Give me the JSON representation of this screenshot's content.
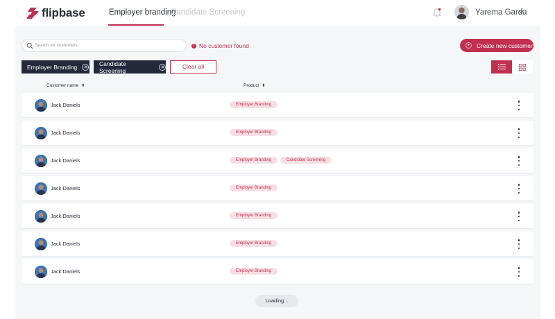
{
  "header": {
    "logo_text": "flipbase",
    "tabs": [
      {
        "label": "Employer branding",
        "active": true
      },
      {
        "label": "Candidate Screening",
        "active": false
      }
    ],
    "user_name": "Yarema Garda"
  },
  "toolbar": {
    "search_placeholder": "Search for customers",
    "search_value": "",
    "no_result_text": "No customer found",
    "create_label": "Create new customer",
    "filters": [
      {
        "label": "Employer Branding"
      },
      {
        "label": "Candidate Screening"
      }
    ],
    "clear_label": "Clear all"
  },
  "table": {
    "columns": [
      "Customer name",
      "Product"
    ],
    "rows": [
      {
        "name": "Jack Daniels",
        "products": [
          "Employer Branding"
        ]
      },
      {
        "name": "Jack Daniels",
        "products": [
          "Employer Branding"
        ]
      },
      {
        "name": "Jack Daniels",
        "products": [
          "Employer Branding",
          "Candidate Screening"
        ]
      },
      {
        "name": "Jack Daniels",
        "products": [
          "Employer Branding"
        ]
      },
      {
        "name": "Jack Daniels",
        "products": [
          "Employer Branding"
        ]
      },
      {
        "name": "Jack Daniels",
        "products": [
          "Employer Branding"
        ]
      },
      {
        "name": "Jack Daniels",
        "products": [
          "Employer Branding"
        ]
      }
    ]
  },
  "loading_label": "Loading...",
  "colors": {
    "accent": "#c2304f",
    "dark": "#23283a",
    "tag_bg": "#f6dfe4",
    "content_bg": "#f5f6f8"
  },
  "icons": {
    "logo": "flipbase-logo-icon",
    "bell": "bell-icon",
    "chevron": "chevron-down-icon",
    "search": "search-icon",
    "alert": "alert-icon",
    "plus": "plus-icon",
    "close": "close-icon",
    "list_view": "list-view-icon",
    "grid_view": "grid-view-icon",
    "sort": "sort-icon",
    "more": "more-vertical-icon"
  }
}
